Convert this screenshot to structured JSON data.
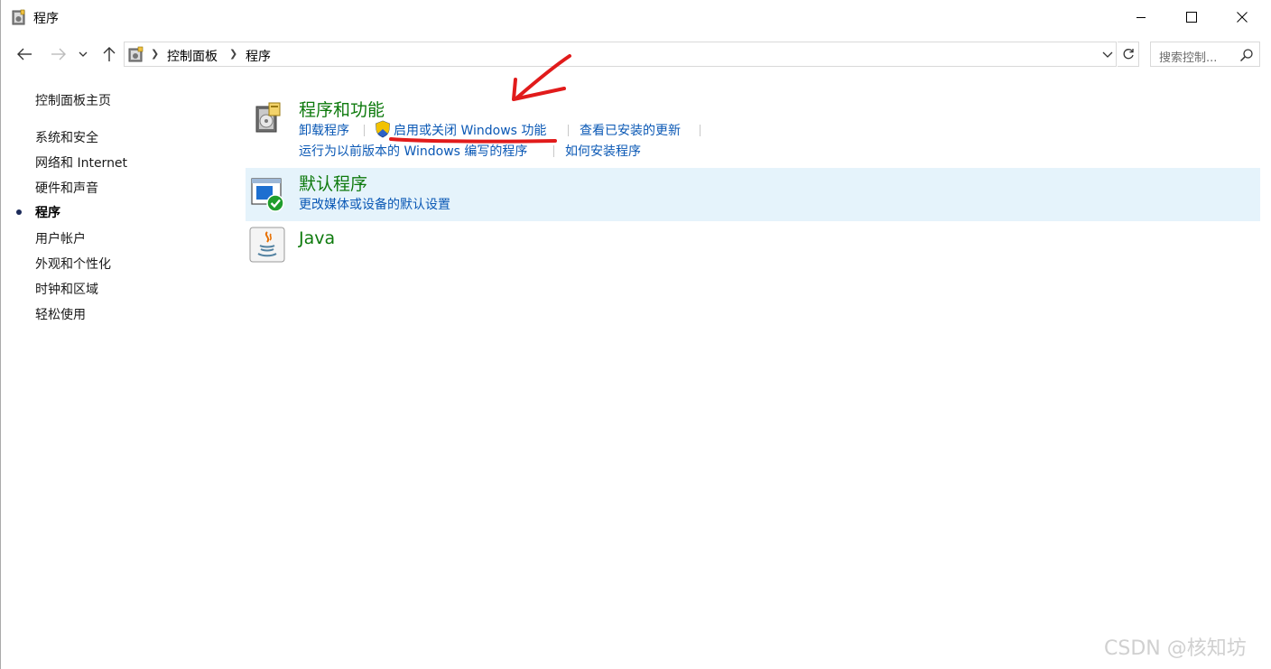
{
  "window": {
    "title": "程序"
  },
  "address": {
    "crumbs": [
      "控制面板",
      "程序"
    ]
  },
  "search": {
    "placeholder": "搜索控制..."
  },
  "leftnav": {
    "items": [
      {
        "label": "控制面板主页",
        "active": false
      },
      {
        "label": "系统和安全",
        "active": false
      },
      {
        "label": "网络和 Internet",
        "active": false
      },
      {
        "label": "硬件和声音",
        "active": false
      },
      {
        "label": "程序",
        "active": true
      },
      {
        "label": "用户帐户",
        "active": false
      },
      {
        "label": "外观和个性化",
        "active": false
      },
      {
        "label": "时钟和区域",
        "active": false
      },
      {
        "label": "轻松使用",
        "active": false
      }
    ]
  },
  "categories": {
    "programs_features": {
      "title": "程序和功能",
      "links": [
        "卸载程序",
        "启用或关闭 Windows 功能",
        "查看已安装的更新",
        "运行为以前版本的 Windows 编写的程序",
        "如何安装程序"
      ]
    },
    "default_programs": {
      "title": "默认程序",
      "links": [
        "更改媒体或设备的默认设置"
      ]
    },
    "java": {
      "title": "Java"
    }
  },
  "colors": {
    "category_title": "#0e7a0d",
    "link": "#0a58b5",
    "highlight": "#e5f3fb",
    "annotation": "#e11b1b"
  },
  "watermark": "CSDN @核知坊"
}
